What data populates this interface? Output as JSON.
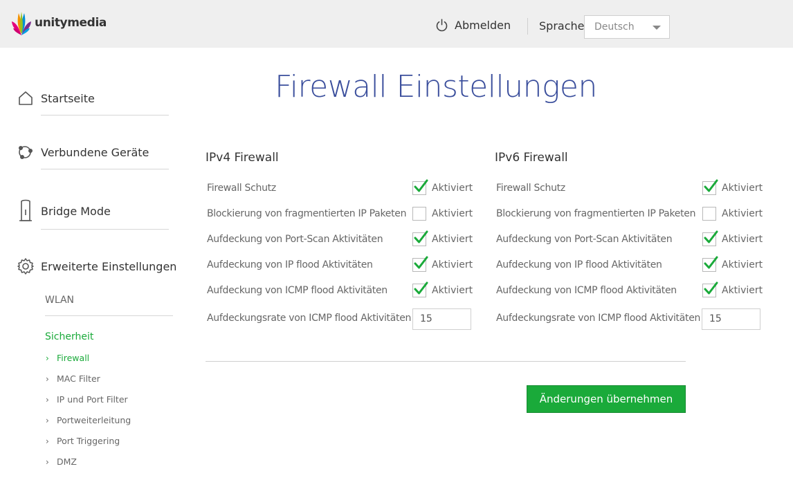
{
  "header": {
    "logo_text": "unitymedia",
    "logout_label": "Abmelden",
    "language_label": "Sprache",
    "language_selected": "Deutsch"
  },
  "sidebar": {
    "items": [
      {
        "label": "Startseite",
        "icon": "home-icon"
      },
      {
        "label": "Verbundene Geräte",
        "icon": "devices-icon"
      },
      {
        "label": "Bridge Mode",
        "icon": "router-icon"
      },
      {
        "label": "Erweiterte Einstellungen",
        "icon": "gear-icon"
      }
    ],
    "sub_items": [
      {
        "label": "WLAN"
      },
      {
        "label": "Sicherheit",
        "active": true
      }
    ],
    "security_items": [
      {
        "label": "Firewall",
        "active": true
      },
      {
        "label": "MAC Filter"
      },
      {
        "label": "IP und Port Filter"
      },
      {
        "label": "Portweiterleitung"
      },
      {
        "label": "Port Triggering"
      },
      {
        "label": "DMZ"
      }
    ]
  },
  "main": {
    "title": "Firewall Einstellungen",
    "ipv4": {
      "title": "IPv4 Firewall",
      "rows": [
        {
          "label": "Firewall Schutz",
          "checked": true,
          "check_label": "Aktiviert"
        },
        {
          "label": "Blockierung von fragmentierten IP Paketen",
          "checked": false,
          "check_label": "Aktiviert"
        },
        {
          "label": "Aufdeckung von Port-Scan Aktivitäten",
          "checked": true,
          "check_label": "Aktiviert"
        },
        {
          "label": "Aufdeckung von IP flood Aktivitäten",
          "checked": true,
          "check_label": "Aktiviert"
        },
        {
          "label": "Aufdeckung von ICMP flood Aktivitäten",
          "checked": true,
          "check_label": "Aktiviert"
        }
      ],
      "rate_label": "Aufdeckungsrate von ICMP flood Aktivitäten",
      "rate_value": "15"
    },
    "ipv6": {
      "title": "IPv6 Firewall",
      "rows": [
        {
          "label": "Firewall Schutz",
          "checked": true,
          "check_label": "Aktiviert"
        },
        {
          "label": "Blockierung von fragmentierten IP Paketen",
          "checked": false,
          "check_label": "Aktiviert"
        },
        {
          "label": "Aufdeckung von Port-Scan Aktivitäten",
          "checked": true,
          "check_label": "Aktiviert"
        },
        {
          "label": "Aufdeckung von IP flood Aktivitäten",
          "checked": true,
          "check_label": "Aktiviert"
        },
        {
          "label": "Aufdeckung von ICMP flood Aktivitäten",
          "checked": true,
          "check_label": "Aktiviert"
        }
      ],
      "rate_label": "Aufdeckungsrate von ICMP flood Aktivitäten",
      "rate_value": "15"
    },
    "apply_label": "Änderungen übernehmen"
  },
  "colors": {
    "accent_green": "#1aaa3a",
    "title_blue": "#3a4e9c",
    "header_bg": "#efefef"
  }
}
